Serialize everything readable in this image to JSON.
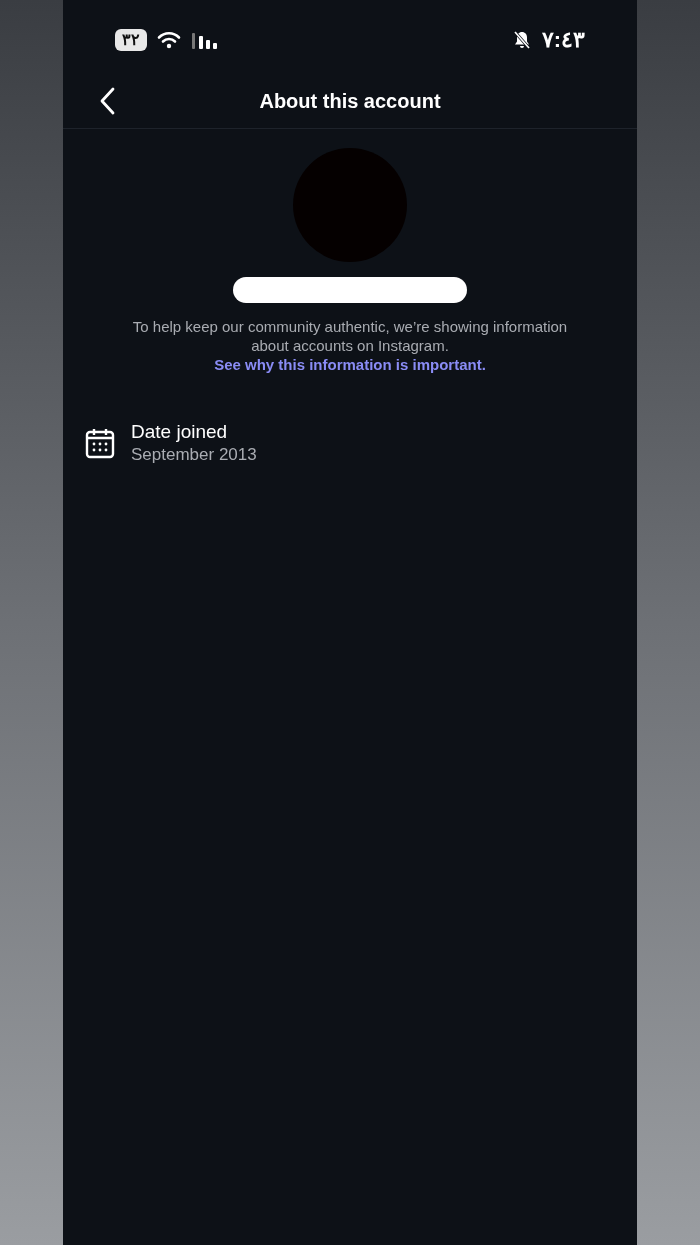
{
  "status_bar": {
    "battery": "٣٢",
    "time": "٧:٤٣"
  },
  "header": {
    "title": "About this account"
  },
  "notice": {
    "text": "To help keep our community authentic, we’re showing information about accounts on Instagram.",
    "link": "See why this information is important."
  },
  "details": [
    {
      "kind": "date",
      "label": "Date joined",
      "value": "September 2013"
    }
  ]
}
